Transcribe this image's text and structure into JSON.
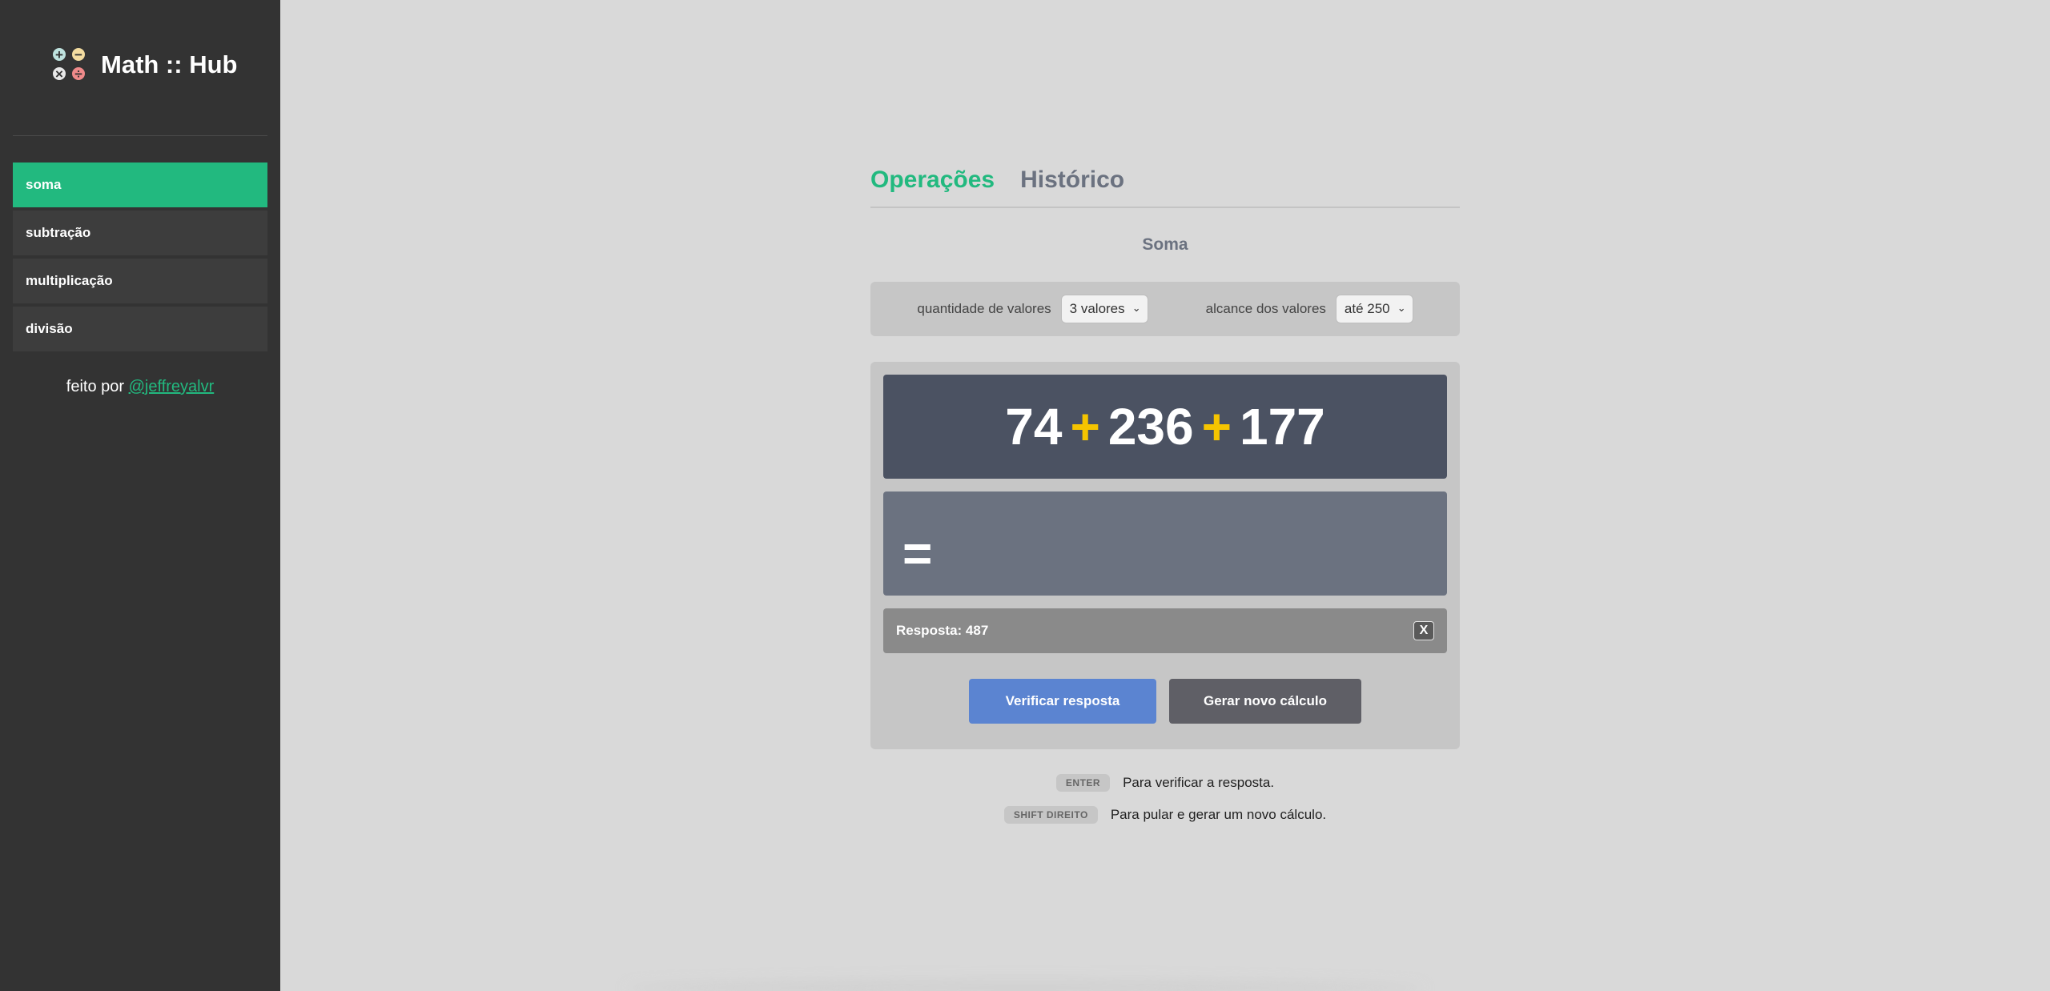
{
  "brand": {
    "title": "Math :: Hub",
    "icons": {
      "plus": "+",
      "minus": "−",
      "times": "×",
      "divide": "÷"
    }
  },
  "sidebar": {
    "items": [
      {
        "label": "soma",
        "active": true
      },
      {
        "label": "subtração",
        "active": false
      },
      {
        "label": "multiplicação",
        "active": false
      },
      {
        "label": "divisão",
        "active": false
      }
    ],
    "credit_prefix": "feito por",
    "credit_link": "@jeffreyalvr"
  },
  "tabs": [
    {
      "label": "Operações",
      "active": true
    },
    {
      "label": "Histórico",
      "active": false
    }
  ],
  "section_title": "Soma",
  "options": {
    "count_label": "quantidade de valores",
    "count_value": "3 valores",
    "range_label": "alcance dos valores",
    "range_value": "até 250"
  },
  "expression": {
    "values": [
      "74",
      "236",
      "177"
    ],
    "operator": "+"
  },
  "answer": {
    "equals": "=",
    "input_value": ""
  },
  "reveal": {
    "text": "Resposta: 487",
    "close_label": "X"
  },
  "buttons": {
    "verify": "Verificar resposta",
    "new": "Gerar novo cálculo"
  },
  "hints": [
    {
      "key": "ENTER",
      "text": "Para verificar a resposta."
    },
    {
      "key": "SHIFT DIREITO",
      "text": "Para pular e gerar um novo cálculo."
    }
  ],
  "colors": {
    "accent": "#22b97f",
    "sidebar_bg": "#333333",
    "operator": "#f5c400",
    "verify_button": "#5b84d1"
  }
}
